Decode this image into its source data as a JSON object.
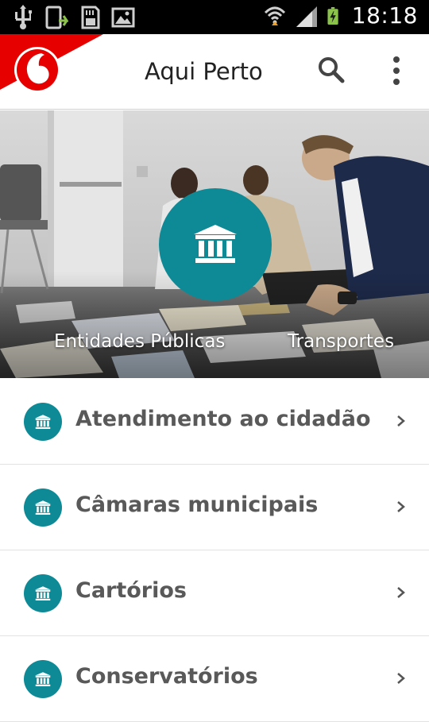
{
  "status_bar": {
    "time": "18:18",
    "icons": [
      "usb-icon",
      "screenshot-icon",
      "sd-card-icon",
      "image-icon",
      "wifi-icon",
      "signal-icon",
      "battery-charging-icon"
    ]
  },
  "app_bar": {
    "title": "Aqui Perto",
    "logo": "vodafone-logo",
    "actions": [
      "search-icon",
      "more-vert-icon"
    ]
  },
  "hero": {
    "icon": "bank-icon",
    "tabs": [
      "Entidades Públicas",
      "Transportes"
    ]
  },
  "list": {
    "items": [
      {
        "label": "Atendimento ao cidadão",
        "icon": "bank-icon"
      },
      {
        "label": "Câmaras municipais",
        "icon": "bank-icon"
      },
      {
        "label": "Cartórios",
        "icon": "bank-icon"
      },
      {
        "label": "Conservatórios",
        "icon": "bank-icon"
      }
    ]
  },
  "colors": {
    "accent": "#0e8a96",
    "brand_red": "#e60000",
    "status_bar": "#000000",
    "text": "#595959"
  }
}
